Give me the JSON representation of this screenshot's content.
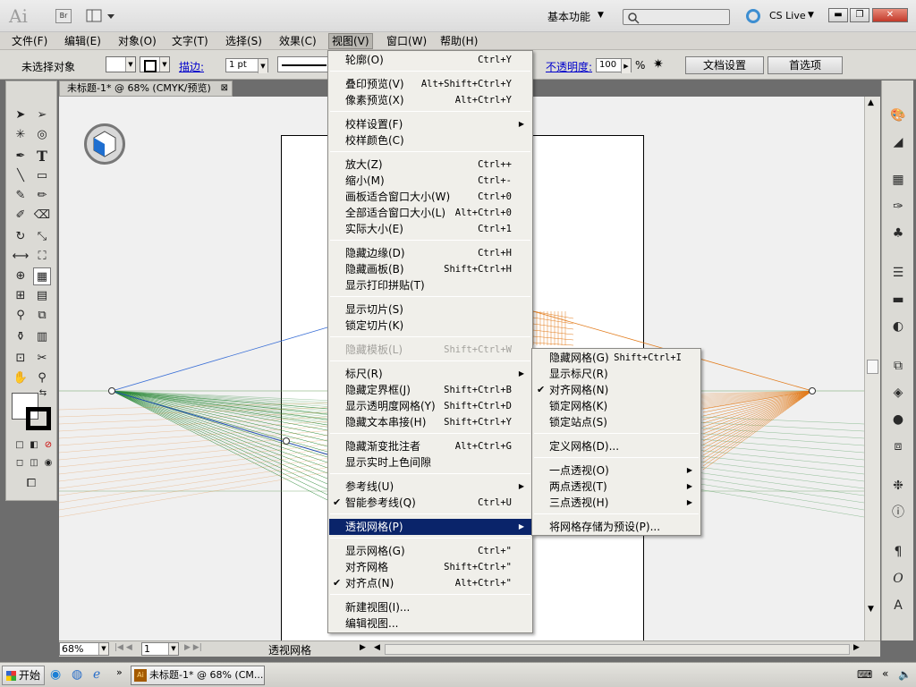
{
  "app": {
    "logo": "Ai",
    "bridge": "Br",
    "workspace": "基本功能",
    "cs_live": "CS Live"
  },
  "menubar": [
    "文件(F)",
    "编辑(E)",
    "对象(O)",
    "文字(T)",
    "选择(S)",
    "效果(C)",
    "视图(V)",
    "窗口(W)",
    "帮助(H)"
  ],
  "control": {
    "no_selection": "未选择对象",
    "stroke_label": "描边:",
    "stroke_value": "1 pt",
    "opacity_label": "不透明度:",
    "opacity_value": "100",
    "opacity_unit": "%",
    "doc_setup": "文档设置",
    "preferences": "首选项"
  },
  "document": {
    "tab": "未标题-1* @ 68% (CMYK/预览)"
  },
  "status": {
    "zoom": "68%",
    "page": "1",
    "text": "透视网格"
  },
  "view_menu": [
    {
      "label": "轮廓(O)",
      "shortcut": "Ctrl+Y"
    },
    {
      "label": "叠印预览(V)",
      "shortcut": "Alt+Shift+Ctrl+Y"
    },
    {
      "label": "像素预览(X)",
      "shortcut": "Alt+Ctrl+Y"
    },
    {
      "label": "校样设置(F)",
      "shortcut": ""
    },
    {
      "label": "校样颜色(C)",
      "shortcut": ""
    },
    {
      "label": "放大(Z)",
      "shortcut": "Ctrl++"
    },
    {
      "label": "缩小(M)",
      "shortcut": "Ctrl+-"
    },
    {
      "label": "画板适合窗口大小(W)",
      "shortcut": "Ctrl+0"
    },
    {
      "label": "全部适合窗口大小(L)",
      "shortcut": "Alt+Ctrl+0"
    },
    {
      "label": "实际大小(E)",
      "shortcut": "Ctrl+1"
    },
    {
      "label": "隐藏边缘(D)",
      "shortcut": "Ctrl+H"
    },
    {
      "label": "隐藏画板(B)",
      "shortcut": "Shift+Ctrl+H"
    },
    {
      "label": "显示打印拼贴(T)",
      "shortcut": ""
    },
    {
      "label": "显示切片(S)",
      "shortcut": ""
    },
    {
      "label": "锁定切片(K)",
      "shortcut": ""
    },
    {
      "label": "隐藏模板(L)",
      "shortcut": "Shift+Ctrl+W"
    },
    {
      "label": "标尺(R)",
      "shortcut": ""
    },
    {
      "label": "隐藏定界框(J)",
      "shortcut": "Shift+Ctrl+B"
    },
    {
      "label": "显示透明度网格(Y)",
      "shortcut": "Shift+Ctrl+D"
    },
    {
      "label": "隐藏文本串接(H)",
      "shortcut": "Shift+Ctrl+Y"
    },
    {
      "label": "隐藏渐变批注者",
      "shortcut": "Alt+Ctrl+G"
    },
    {
      "label": "显示实时上色间隙",
      "shortcut": ""
    },
    {
      "label": "参考线(U)",
      "shortcut": ""
    },
    {
      "label": "智能参考线(Q)",
      "shortcut": "Ctrl+U"
    },
    {
      "label": "透视网格(P)",
      "shortcut": ""
    },
    {
      "label": "显示网格(G)",
      "shortcut": "Ctrl+\""
    },
    {
      "label": "对齐网格",
      "shortcut": "Shift+Ctrl+\""
    },
    {
      "label": "对齐点(N)",
      "shortcut": "Alt+Ctrl+\""
    },
    {
      "label": "新建视图(I)...",
      "shortcut": ""
    },
    {
      "label": "编辑视图...",
      "shortcut": ""
    }
  ],
  "submenu": [
    {
      "label": "隐藏网格(G)",
      "shortcut": "Shift+Ctrl+I"
    },
    {
      "label": "显示标尺(R)",
      "shortcut": ""
    },
    {
      "label": "对齐网格(N)",
      "shortcut": ""
    },
    {
      "label": "锁定网格(K)",
      "shortcut": ""
    },
    {
      "label": "锁定站点(S)",
      "shortcut": ""
    },
    {
      "label": "定义网格(D)...",
      "shortcut": ""
    },
    {
      "label": "一点透视(O)",
      "shortcut": ""
    },
    {
      "label": "两点透视(T)",
      "shortcut": ""
    },
    {
      "label": "三点透视(H)",
      "shortcut": ""
    },
    {
      "label": "将网格存储为预设(P)...",
      "shortcut": ""
    }
  ],
  "taskbar": {
    "start": "开始",
    "task": "未标题-1* @ 68% (CM..."
  },
  "colors": {
    "highlight": "#0a246a",
    "link": "#0000cc",
    "left_grid": "#2e8b3a",
    "right_grid": "#e27b1b",
    "horizon": "#6aa05f"
  }
}
